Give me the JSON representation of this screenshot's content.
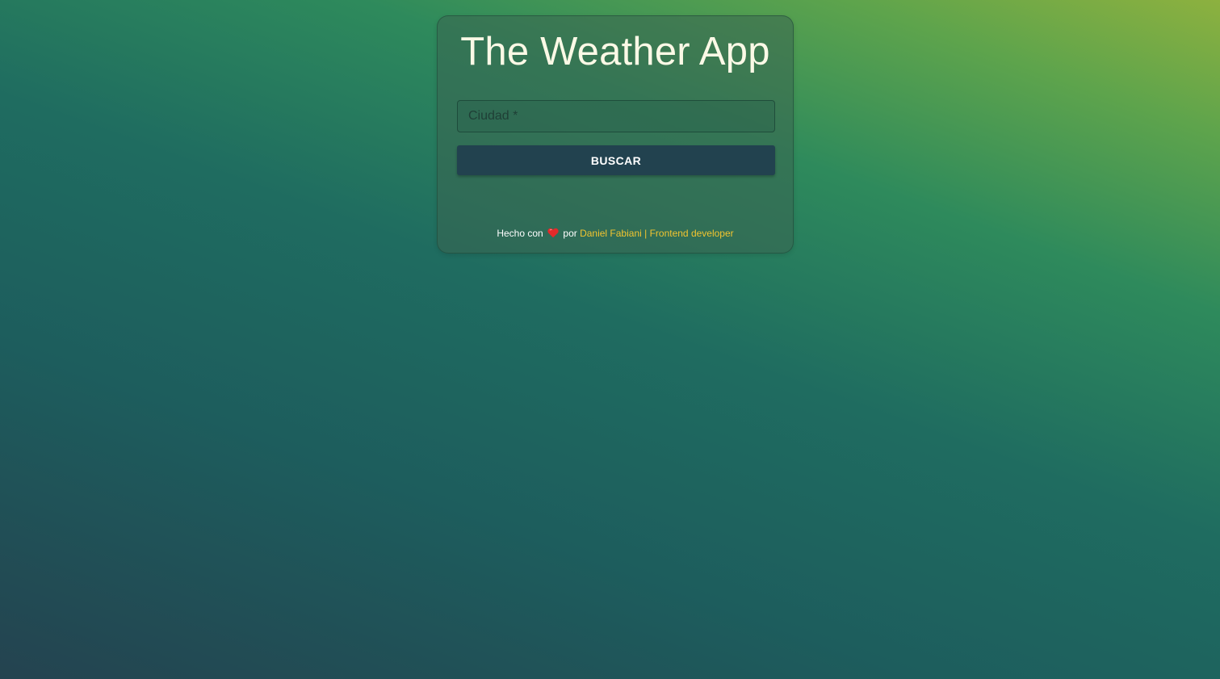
{
  "app": {
    "title": "The Weather App"
  },
  "search": {
    "placeholder": "Ciudad *",
    "value": "",
    "button_label": "BUSCAR"
  },
  "footer": {
    "prefix": "Hecho con",
    "icon": "heart-icon",
    "middle": "por",
    "link_text": "Daniel Fabiani | Frontend developer"
  },
  "colors": {
    "button_bg": "#22424f",
    "link": "#f2c530",
    "title": "#fbf9e6",
    "heart": "#e32a2a"
  }
}
